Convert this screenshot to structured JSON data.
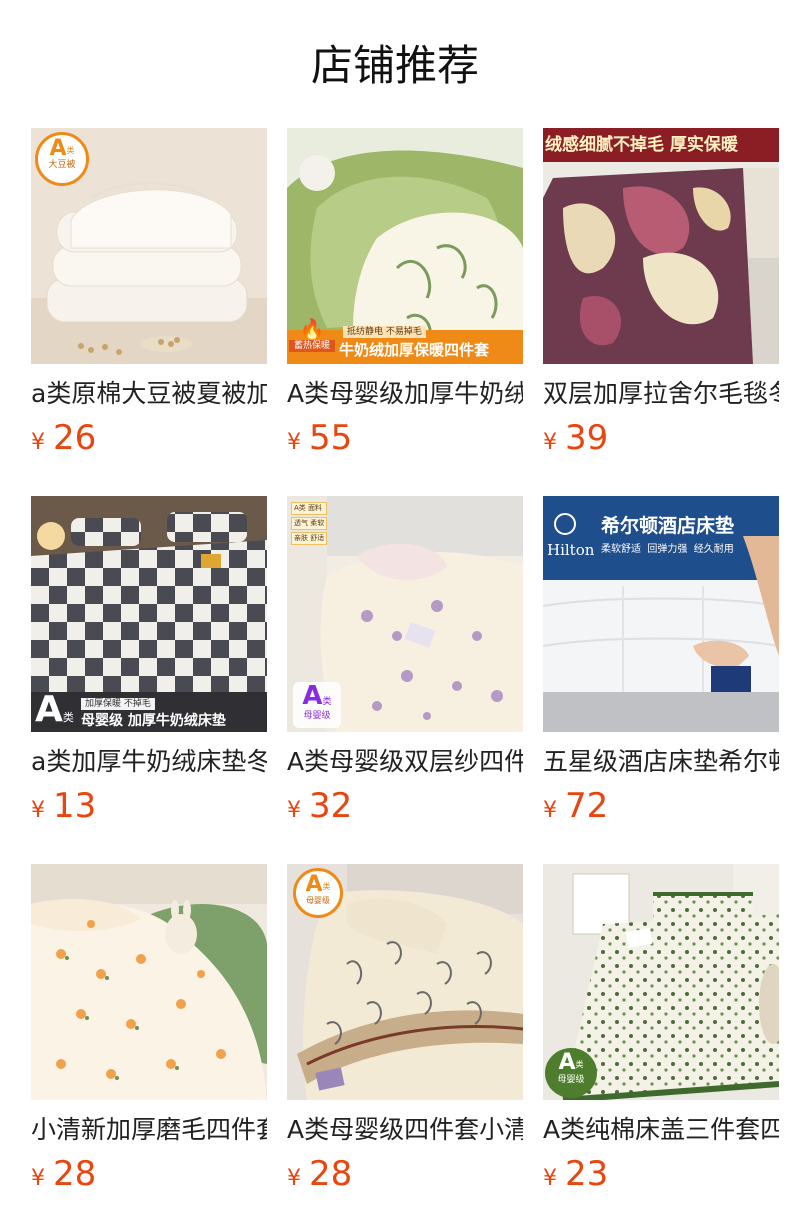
{
  "page": {
    "title": "店铺推荐"
  },
  "theme": {
    "price_color": "#e8450f",
    "badge_orange": "#f08a17",
    "badge_purple": "#8a2be2"
  },
  "products": [
    {
      "name": "a类原棉大豆被夏被加厚",
      "currency": "¥",
      "price": "26",
      "badge": {
        "letter": "A",
        "sub": "类",
        "caption": "大豆被"
      },
      "image_icon": "quilt-image"
    },
    {
      "name": "A类母婴级加厚牛奶绒四件套",
      "currency": "¥",
      "price": "55",
      "banner": "牛奶绒加厚保暖四件套",
      "tag": "蓄热保暖",
      "tag_small": "抵纺静电 不易掉毛",
      "image_icon": "bedding-image"
    },
    {
      "name": "双层加厚拉舍尔毛毯冬季",
      "currency": "¥",
      "price": "39",
      "banner": "绒感细腻不掉毛 厚实保暖",
      "image_icon": "blanket-image"
    },
    {
      "name": "a类加厚牛奶绒床垫冬季",
      "currency": "¥",
      "price": "13",
      "banner": "母婴级 加厚牛奶绒床垫",
      "tag_small": "加厚保暖 不掉毛",
      "badge": {
        "letter": "A",
        "sub": "类"
      },
      "image_icon": "mattress-pad-image"
    },
    {
      "name": "A类母婴级双层纱四件套",
      "currency": "¥",
      "price": "32",
      "badge": {
        "letter": "A",
        "sub": "类",
        "caption": "母婴级"
      },
      "tags": [
        "A类 面料",
        "透气 柔软",
        "亲肤 舒适"
      ],
      "image_icon": "bedding-image"
    },
    {
      "name": "五星级酒店床垫希尔顿",
      "currency": "¥",
      "price": "72",
      "banner": "希尔顿酒店床垫",
      "brand": "Hilton",
      "banner_sub": "柔软舒适  回弹力强  经久耐用",
      "image_icon": "hotel-mattress-image"
    },
    {
      "name": "小清新加厚磨毛四件套",
      "currency": "¥",
      "price": "28",
      "image_icon": "floral-bedding-image"
    },
    {
      "name": "A类母婴级四件套小清新",
      "currency": "¥",
      "price": "28",
      "badge": {
        "letter": "A",
        "sub": "类",
        "caption": "母婴级"
      },
      "image_icon": "leaf-bedding-image"
    },
    {
      "name": "A类纯棉床盖三件套四季",
      "currency": "¥",
      "price": "23",
      "badge": {
        "letter": "A",
        "sub": "类",
        "caption": "母婴级"
      },
      "image_icon": "bedspread-image"
    }
  ]
}
